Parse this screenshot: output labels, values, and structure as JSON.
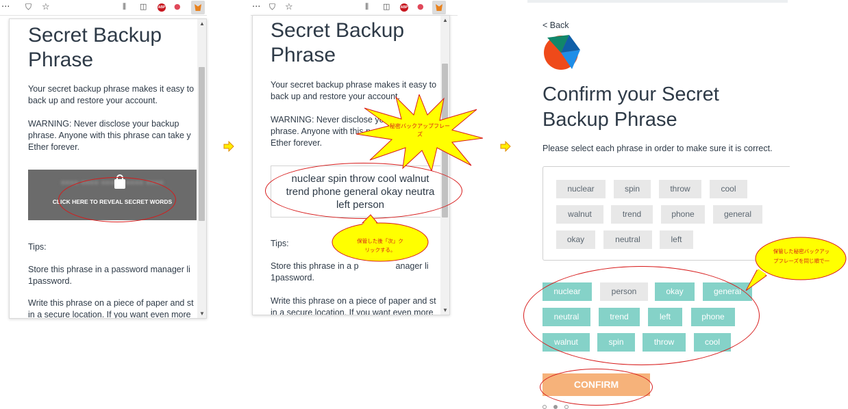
{
  "panel1": {
    "title_line1": "Secret Backup",
    "title_line2": "Phrase",
    "intro_l1": "Your secret backup phrase makes it easy to",
    "intro_l2": "back up and restore your account.",
    "warn_l1": "WARNING: Never disclose your backup",
    "warn_l2": "phrase. Anyone with this phrase can take y",
    "warn_l3": "Ether forever.",
    "reveal_label": "CLICK HERE TO REVEAL SECRET WORDS",
    "tips": "Tips:",
    "tip1_l1": "Store this phrase in a password manager li",
    "tip1_l2": "1password.",
    "tip2_l1": "Write this phrase on a piece of paper and st",
    "tip2_l2": "in a secure location. If you want even more"
  },
  "panel2": {
    "title_line1": "Secret Backup",
    "title_line2": "Phrase",
    "intro_l1": "Your secret backup phrase makes it easy to",
    "intro_l2": "back up and restore your account.",
    "warn_l1": "WARNING: Never disclose yo",
    "warn_l2": "phrase. Anyone with this p",
    "warn_l3": "Ether forever.",
    "words_l1": "nuclear spin throw cool walnut",
    "words_l2": "trend phone general okay neutra",
    "words_l3": "left person",
    "tips": "Tips:",
    "tip1_l1": "Store this phrase in a p",
    "tip1_l1b": "anager li",
    "tip1_l2": "1password.",
    "tip2_l1": "Write this phrase on a piece of paper and st",
    "tip2_l2": "in a secure location. If you want even more",
    "starburst_note": "秘密バックアップフレーズ",
    "callout_note_l1": "保管した後「次」ク",
    "callout_note_l2": "リックする。"
  },
  "panel3": {
    "back": "< Back",
    "title_l1": "Confirm your Secret",
    "title_l2": "Backup Phrase",
    "instruction": "Please select each phrase in order to make sure it is correct.",
    "selected_words": [
      "nuclear",
      "spin",
      "throw",
      "cool",
      "walnut",
      "trend",
      "phone",
      "general",
      "okay",
      "neutral",
      "left"
    ],
    "choice_words": [
      "nuclear",
      "person",
      "okay",
      "general",
      "neutral",
      "trend",
      "left",
      "phone",
      "walnut",
      "spin",
      "throw",
      "cool"
    ],
    "confirm": "CONFIRM",
    "callout_note_l1": "保管した秘密バックアッ",
    "callout_note_l2": "プフレーズを同じ順で一"
  },
  "colors": {
    "teal": "#85d2c8",
    "confirm_orange": "#f6b27a",
    "annotation_red": "#d71a1a",
    "callout_yellow": "#ffff00"
  }
}
